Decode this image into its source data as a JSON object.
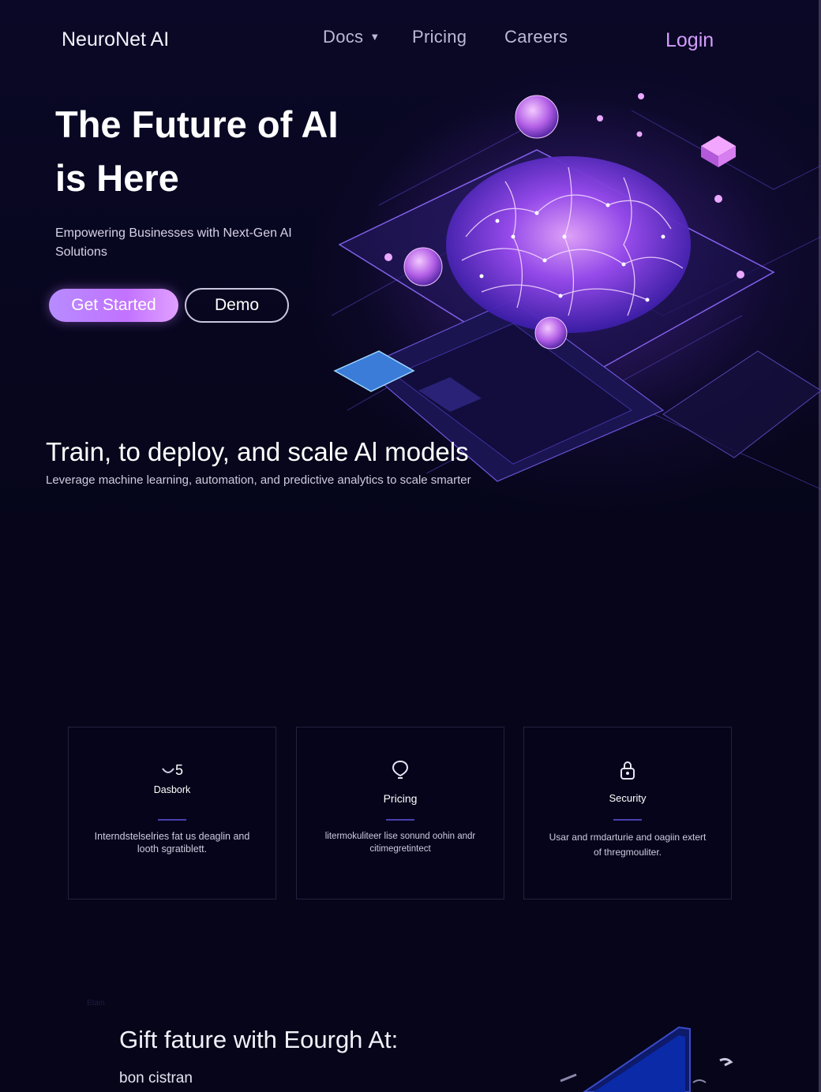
{
  "nav": {
    "brand": "NeuroNet AI",
    "items": [
      {
        "label": "Docs",
        "caret": "▼"
      },
      {
        "label": "Pricing"
      },
      {
        "label": "Careers"
      }
    ],
    "login": "Login"
  },
  "hero": {
    "title_line1": "The Future of AI",
    "title_line2": "is Here",
    "subtitle": "Empowering Businesses with Next-Gen AI Solutions",
    "primary_button": "Get Started",
    "secondary_button": "Demo"
  },
  "section2": {
    "title": "Train, to deploy, and scale Al models",
    "subtitle": "Leverage machine learning, automation, and predictive analytics to scale smarter"
  },
  "cards": [
    {
      "icon": "dashboard-gauge-icon",
      "stat": "5",
      "title": "Dasbork",
      "description": "Interndstelselries fat us deaglin and looth sgratiblett."
    },
    {
      "icon": "location-pin-icon",
      "title": "Pricing",
      "description": "litermokuliteer lise sonund oohin andr citimegretintect"
    },
    {
      "icon": "lock-icon",
      "title": "Security",
      "description": "Usar and rmdarturie and oagiin extert of thregmouliter."
    }
  ],
  "bottom": {
    "tag": "Etain",
    "title": "Gift fature with Eourgh At:",
    "subtitle": "bon cistran"
  },
  "colors": {
    "background": "#06051a",
    "accent": "#c272ff",
    "login": "#d59cff",
    "card_rule": "#4b3fb0"
  }
}
